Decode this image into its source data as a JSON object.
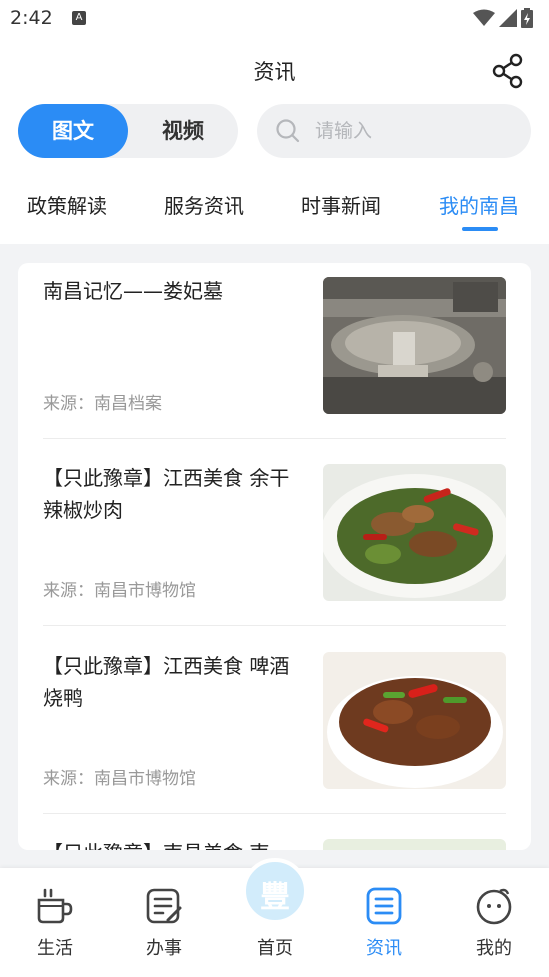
{
  "status_bar": {
    "time": "2:42",
    "notification_glyph": "A"
  },
  "header": {
    "title": "资讯"
  },
  "segmented": {
    "options": [
      "图文",
      "视频"
    ],
    "selected": "图文"
  },
  "search": {
    "placeholder": "请输入",
    "value": ""
  },
  "tabs": [
    {
      "label": "政策解读"
    },
    {
      "label": "服务资讯"
    },
    {
      "label": "时事新闻"
    },
    {
      "label": "我的南昌"
    }
  ],
  "active_tab": "我的南昌",
  "articles": [
    {
      "title": "南昌记忆——娄妃墓",
      "source": "来源：南昌档案"
    },
    {
      "title": "【只此豫章】江西美食 余干辣椒炒肉",
      "source": "来源：南昌市博物馆"
    },
    {
      "title": "【只此豫章】江西美食 啤酒烧鸭",
      "source": "来源：南昌市博物馆"
    },
    {
      "title": "【只此豫章】南昌美食 南",
      "source": ""
    }
  ],
  "bottom_nav": [
    {
      "label": "生活",
      "icon": "cup-icon"
    },
    {
      "label": "办事",
      "icon": "memo-icon"
    },
    {
      "label": "首页",
      "icon": "home-logo-icon"
    },
    {
      "label": "资讯",
      "icon": "news-icon"
    },
    {
      "label": "我的",
      "icon": "profile-icon"
    }
  ],
  "active_nav": "资讯",
  "home_logo_glyph": "豐",
  "colors": {
    "accent": "#2b8cf5",
    "background": "#f2f3f5",
    "home_circle": "#d2ecfb"
  }
}
